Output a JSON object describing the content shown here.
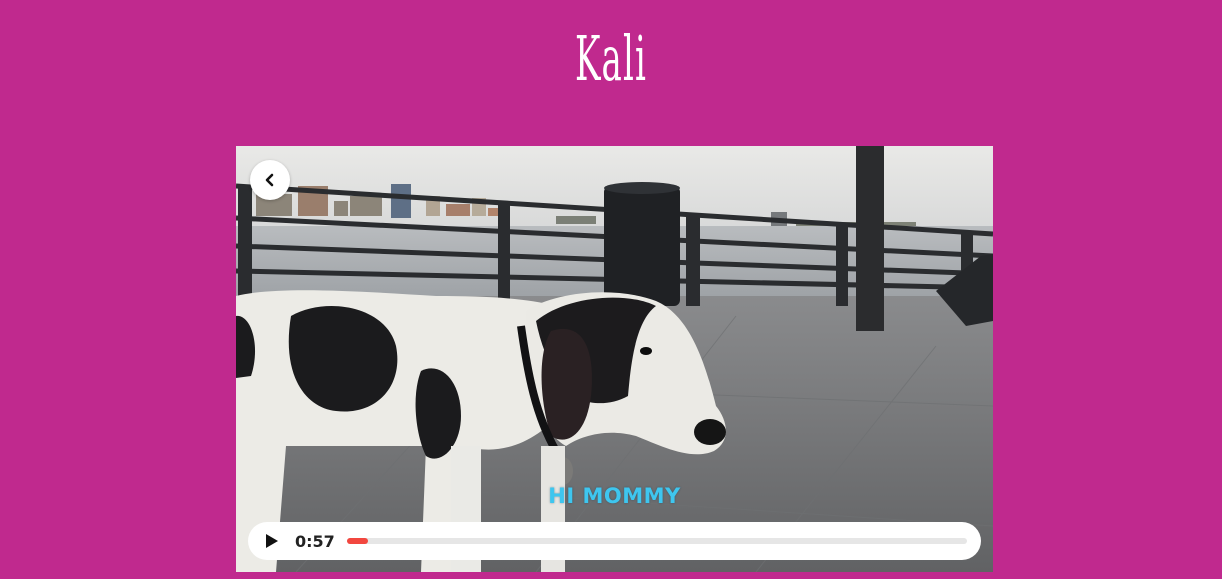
{
  "page": {
    "title": "Kali",
    "background_color": "#c0298e"
  },
  "video": {
    "caption": "HI MOMMY",
    "back_icon": "chevron-left-icon",
    "play_icon": "play-icon",
    "current_time": "0:57",
    "progress_fraction": 0.035,
    "progress_color": "#f2473f",
    "caption_color": "#3ec6ef"
  }
}
